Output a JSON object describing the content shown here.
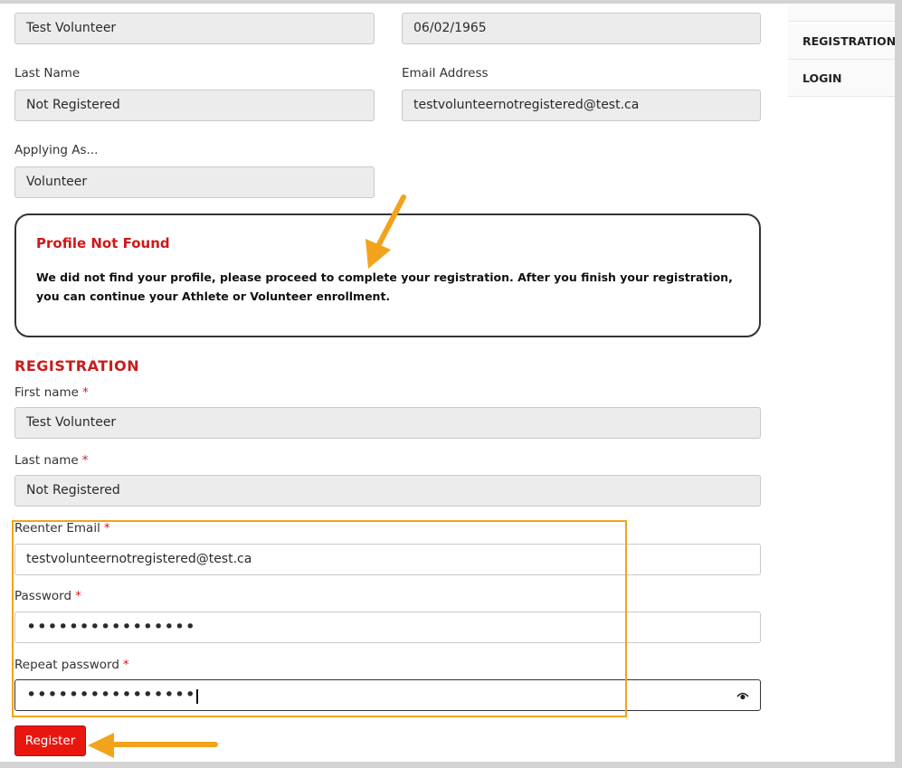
{
  "top_fields": {
    "first_name_value": "Test Volunteer",
    "dob_value": "06/02/1965",
    "last_name_label": "Last Name",
    "last_name_value": "Not Registered",
    "email_label": "Email Address",
    "email_value": "testvolunteernotregistered@test.ca",
    "applying_label": "Applying As...",
    "applying_value": "Volunteer"
  },
  "side_menu": {
    "items": [
      "REGISTRATION",
      "LOGIN"
    ]
  },
  "notice": {
    "title": "Profile Not Found",
    "text": "We did not find your profile, please proceed to complete your registration. After you finish your registration, you can continue your Athlete or Volunteer enrollment."
  },
  "registration": {
    "heading": "REGISTRATION",
    "required_marker": "*",
    "first_name_label": "First name",
    "first_name_value": "Test Volunteer",
    "last_name_label": "Last name",
    "last_name_value": "Not Registered",
    "reenter_email_label": "Reenter Email",
    "reenter_email_value": "testvolunteernotregistered@test.ca",
    "password_label": "Password",
    "password_value": "••••••••••••••••",
    "repeat_password_label": "Repeat password",
    "repeat_password_value": "••••••••••••••••",
    "register_button": "Register"
  },
  "colors": {
    "accent_red": "#d01818",
    "annotation_orange": "#f2a31c",
    "field_bg": "#ececec"
  }
}
